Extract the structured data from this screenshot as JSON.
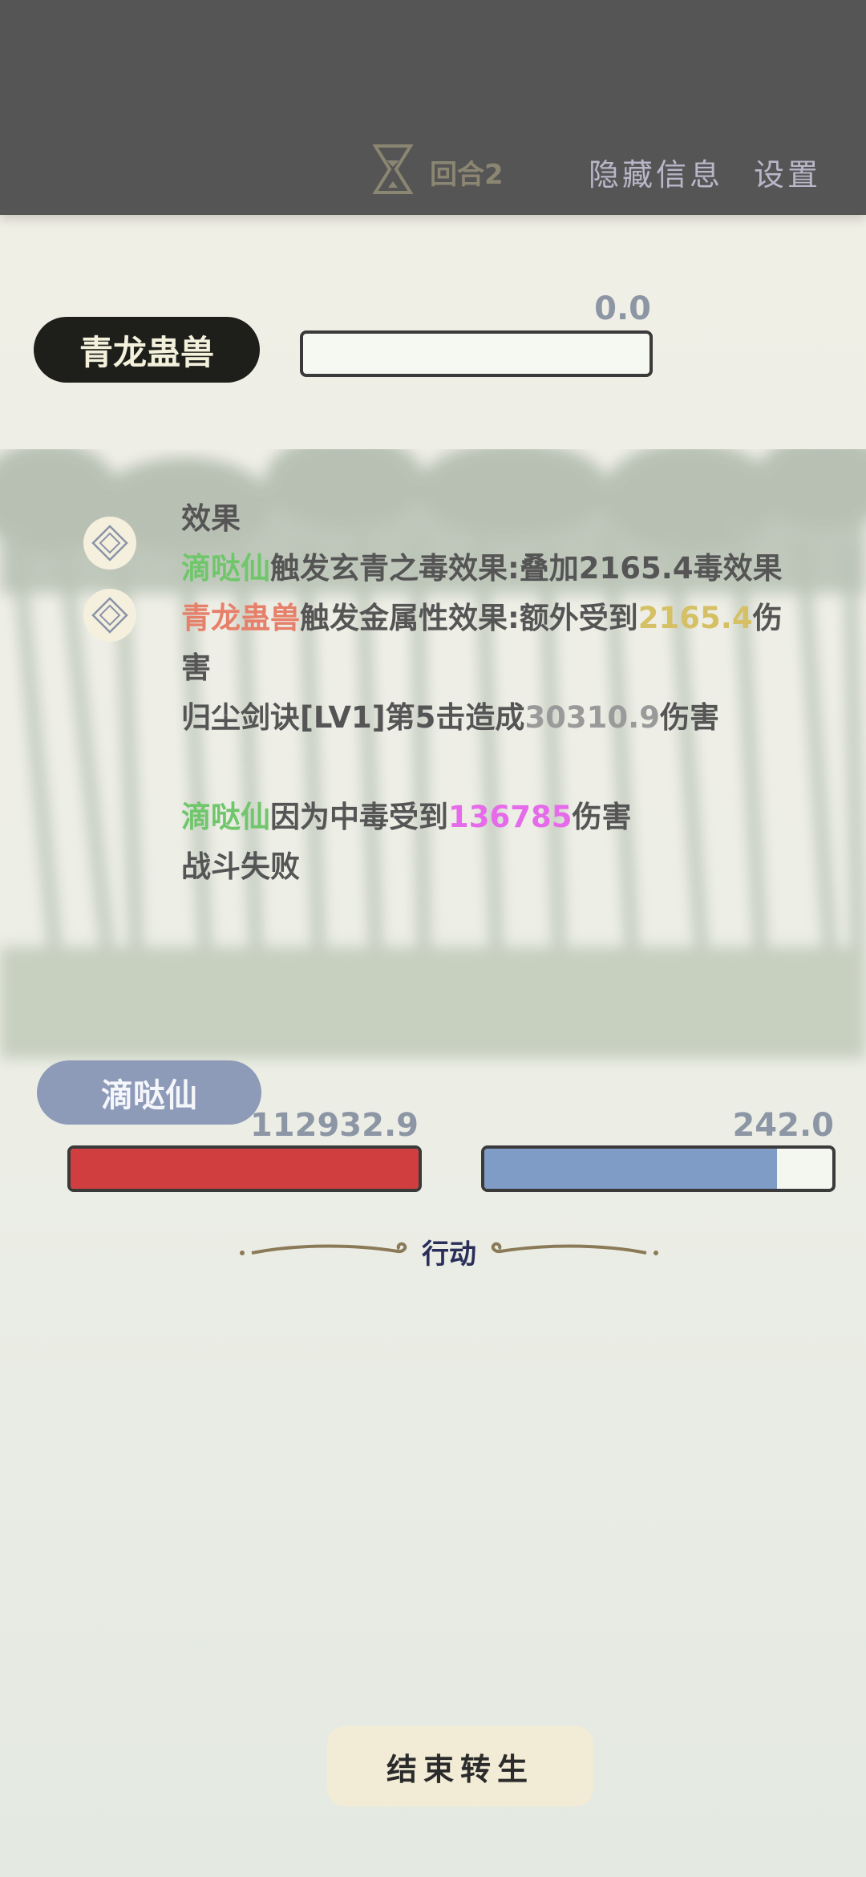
{
  "topbar": {
    "round_label": "回合2",
    "hide_info_label": "隐藏信息",
    "settings_label": "设置"
  },
  "enemy": {
    "name": "青龙蛊兽",
    "value": "0.0",
    "bar_fill": 0.0
  },
  "log": {
    "header": "效果",
    "lines": [
      {
        "segments": [
          {
            "text": "滴哒仙",
            "color": "green"
          },
          {
            "text": "触发玄青之毒效果:叠加2165.4毒效果",
            "color": "default"
          }
        ]
      },
      {
        "segments": [
          {
            "text": "青龙蛊兽",
            "color": "red"
          },
          {
            "text": "触发金属性效果:额外受到",
            "color": "default"
          },
          {
            "text": "2165.4",
            "color": "gold"
          },
          {
            "text": "伤害",
            "color": "default"
          }
        ]
      },
      {
        "segments": [
          {
            "text": "归尘剑诀[LV1]第5击造成",
            "color": "default"
          },
          {
            "text": "30310.9",
            "color": "gray"
          },
          {
            "text": "伤害",
            "color": "default"
          }
        ]
      },
      {
        "segments": [
          {
            "text": "滴哒仙",
            "color": "green"
          },
          {
            "text": "因为中毒受到",
            "color": "default"
          },
          {
            "text": "136785",
            "color": "pink"
          },
          {
            "text": "伤害",
            "color": "default"
          }
        ]
      },
      {
        "segments": [
          {
            "text": "战斗失败",
            "color": "default"
          }
        ]
      }
    ]
  },
  "player": {
    "name": "滴哒仙",
    "hp_value": "112932.9",
    "hp_fill": 1.0,
    "mp_value": "242.0",
    "mp_fill": 0.84
  },
  "divider_label": "行动",
  "end_button_label": "结束转生",
  "icons": {
    "round_icon": "hourglass-icon",
    "skill_icon": "diamond-skill-icon"
  },
  "colors": {
    "topbar": "#555555",
    "hp": "#d13e3f",
    "mp": "#7f9cc6",
    "log_green": "#6fc66b",
    "log_red": "#e6806a",
    "log_gold": "#d6c065",
    "log_pink": "#e66bea"
  }
}
